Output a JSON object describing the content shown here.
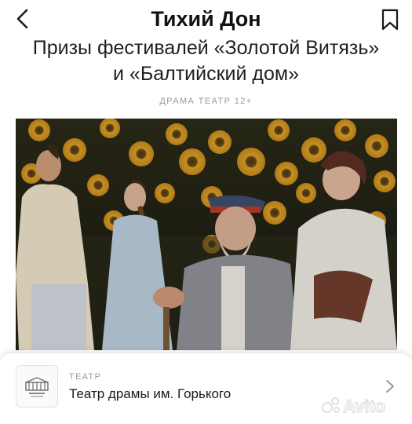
{
  "header": {
    "title": "Тихий Дон"
  },
  "subtitle": "Призы фестивалей «Золотой Витязь» и «Балтийский дом»",
  "meta": "ДРАМА ТЕАТР 12+",
  "venue": {
    "kind": "ТЕАТР",
    "name": "Театр драмы им. Горького"
  },
  "watermark": "Avito",
  "icons": {
    "back": "chevron-left-icon",
    "bookmark": "bookmark-icon",
    "forward": "chevron-right-icon"
  }
}
